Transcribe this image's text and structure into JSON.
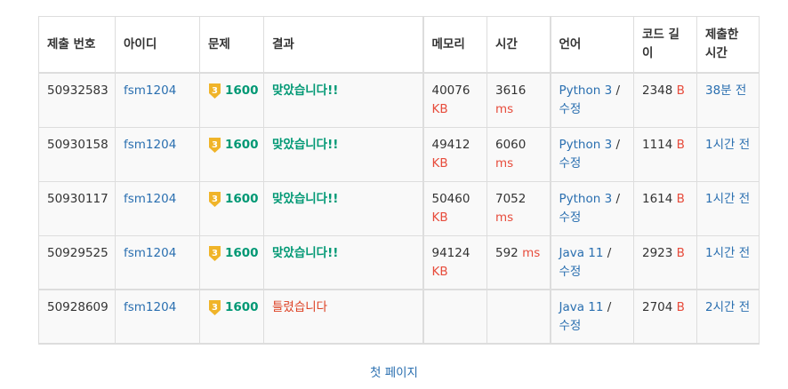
{
  "headers": {
    "submission_id": "제출 번호",
    "user": "아이디",
    "problem": "문제",
    "result": "결과",
    "memory": "메모리",
    "time": "시간",
    "language": "언어",
    "code_length": "코드 길이",
    "submitted": "제출한 시간"
  },
  "units": {
    "memory": "KB",
    "time": "ms",
    "length": "B"
  },
  "colors": {
    "accepted": "#009874",
    "wrong": "#dd4124",
    "link": "#2a6fb0",
    "unit": "#e74c3c",
    "tier_badge": "#f0b429"
  },
  "tier_icon": "bronze-3-tier-icon",
  "rows": [
    {
      "id": "50932583",
      "user": "fsm1204",
      "tier": "3",
      "problem": "1600",
      "result": "맞았습니다!!",
      "result_type": "accepted",
      "memory": "40076",
      "time": "3616",
      "lang": "Python 3",
      "edit": "수정",
      "length": "2348",
      "ago": "38분 전"
    },
    {
      "id": "50930158",
      "user": "fsm1204",
      "tier": "3",
      "problem": "1600",
      "result": "맞았습니다!!",
      "result_type": "accepted",
      "memory": "49412",
      "time": "6060",
      "lang": "Python 3",
      "edit": "수정",
      "length": "1114",
      "ago": "1시간 전"
    },
    {
      "id": "50930117",
      "user": "fsm1204",
      "tier": "3",
      "problem": "1600",
      "result": "맞았습니다!!",
      "result_type": "accepted",
      "memory": "50460",
      "time": "7052",
      "lang": "Python 3",
      "edit": "수정",
      "length": "1614",
      "ago": "1시간 전"
    },
    {
      "id": "50929525",
      "user": "fsm1204",
      "tier": "3",
      "problem": "1600",
      "result": "맞았습니다!!",
      "result_type": "accepted",
      "memory": "94124",
      "time": "592",
      "lang": "Java 11",
      "edit": "수정",
      "length": "2923",
      "ago": "1시간 전"
    },
    {
      "id": "50928609",
      "user": "fsm1204",
      "tier": "3",
      "problem": "1600",
      "result": "틀렸습니다",
      "result_type": "wrong",
      "memory": "",
      "time": "",
      "lang": "Java 11",
      "edit": "수정",
      "length": "2704",
      "ago": "2시간 전"
    }
  ],
  "pagination": {
    "first_page": "첫 페이지"
  }
}
